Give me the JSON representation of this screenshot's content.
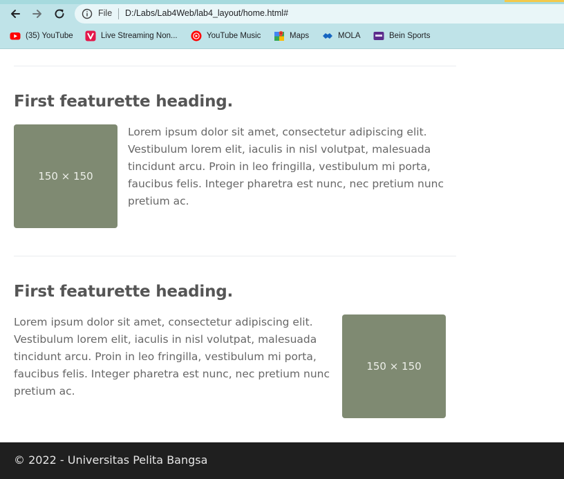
{
  "browser": {
    "address": {
      "scheme_label": "File",
      "url": "D:/Labs/Lab4Web/lab4_layout/home.html#"
    },
    "bookmarks": [
      {
        "label": "(35) YouTube",
        "icon": "youtube-icon"
      },
      {
        "label": "Live Streaming Non...",
        "icon": "streaming-icon"
      },
      {
        "label": "YouTube Music",
        "icon": "youtube-music-icon"
      },
      {
        "label": "Maps",
        "icon": "maps-icon"
      },
      {
        "label": "MOLA",
        "icon": "mola-icon"
      },
      {
        "label": "Bein Sports",
        "icon": "bein-sports-icon"
      }
    ]
  },
  "featurettes": [
    {
      "heading": "First featurette heading.",
      "image_label": "150 × 150",
      "text_lines": [
        "Lorem ipsum dolor sit amet, consectetur adipiscing elit.",
        "Vestibulum lorem elit, iaculis in nisl volutpat, malesuada",
        "tincidunt arcu. Proin in leo fringilla, vestibulum mi porta,",
        "faucibus felis. Integer pharetra est nunc, nec pretium nunc",
        "pretium ac."
      ]
    },
    {
      "heading": "First featurette heading.",
      "image_label": "150 × 150",
      "text_lines": [
        "Lorem ipsum dolor sit amet, consectetur adipiscing elit.",
        "Vestibulum lorem elit, iaculis in nisl volutpat, malesuada",
        "tincidunt arcu. Proin in leo fringilla, vestibulum mi porta,",
        "faucibus felis. Integer pharetra est nunc, nec pretium nunc",
        "pretium ac."
      ]
    }
  ],
  "footer": {
    "text": "© 2022 - Universitas Pelita Bangsa"
  },
  "colors": {
    "placeholder": "#7f8a72",
    "footer_bg": "#1f1f1f",
    "chrome_bg": "#bfe3e8"
  }
}
